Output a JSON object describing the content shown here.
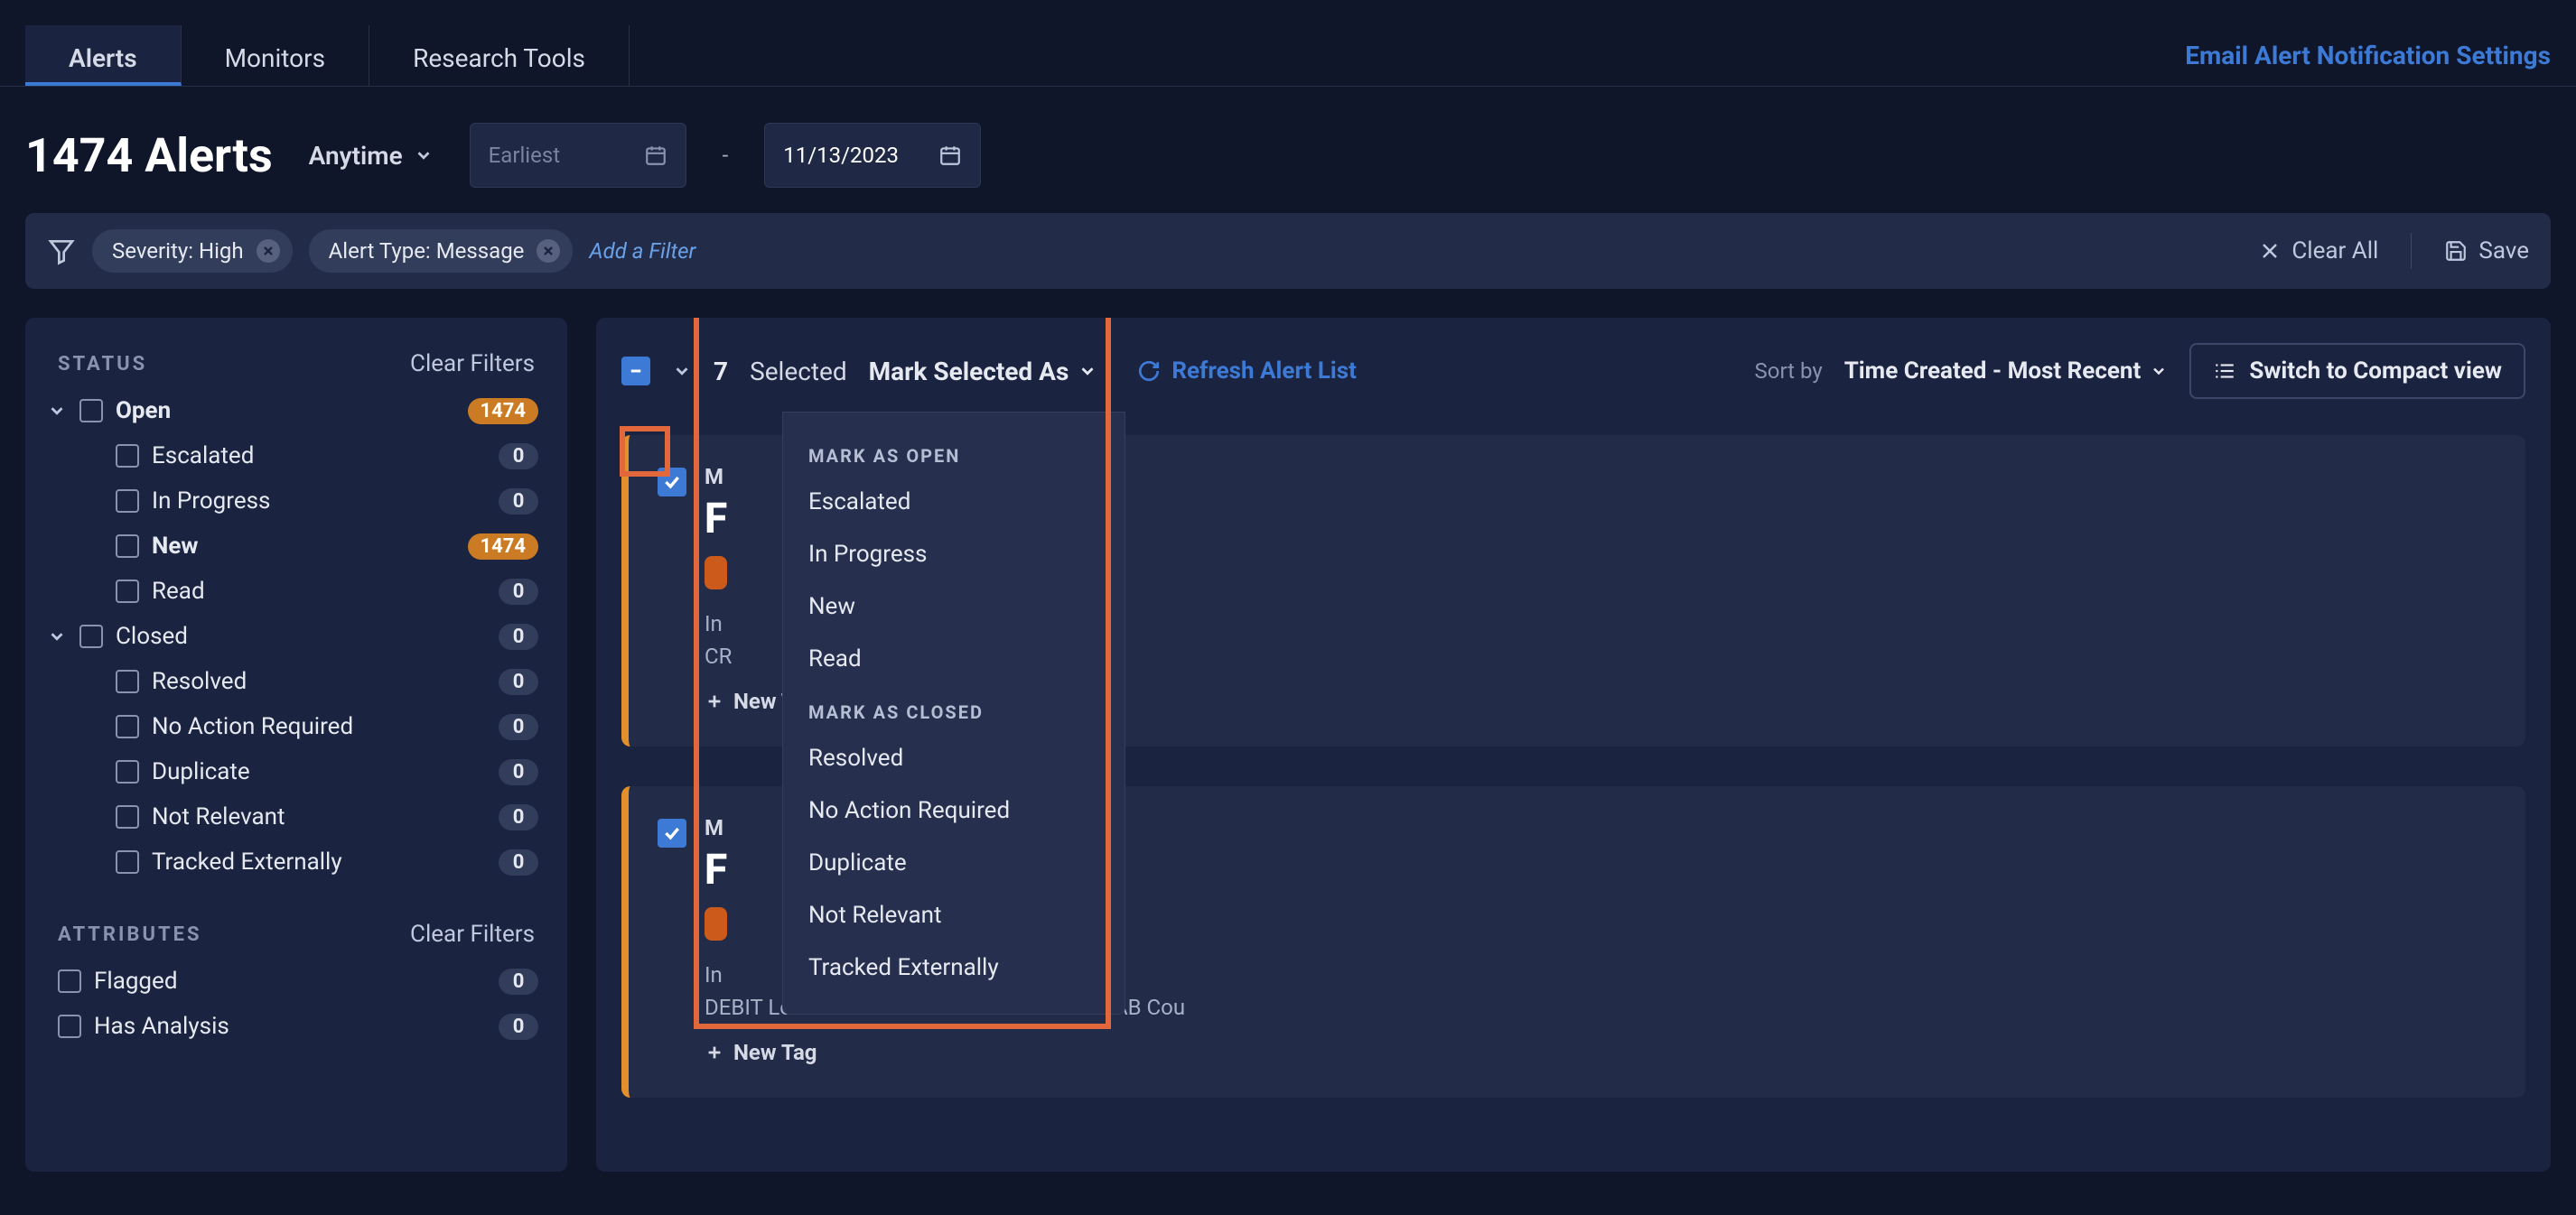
{
  "tabs": {
    "alerts": "Alerts",
    "monitors": "Monitors",
    "research": "Research Tools"
  },
  "email_settings": "Email Alert Notification Settings",
  "page_title": "1474 Alerts",
  "anytime": "Anytime",
  "earliest_placeholder": "Earliest",
  "end_date": "11/13/2023",
  "filter_pill1": "Severity: High",
  "filter_pill2": "Alert Type: Message",
  "add_filter": "Add a Filter",
  "clear_all": "Clear All",
  "save": "Save",
  "sidebar": {
    "status_label": "STATUS",
    "attributes_label": "ATTRIBUTES",
    "clear_filters": "Clear Filters",
    "open": {
      "label": "Open",
      "count": "1474"
    },
    "escalated": {
      "label": "Escalated",
      "count": "0"
    },
    "inprogress": {
      "label": "In Progress",
      "count": "0"
    },
    "new": {
      "label": "New",
      "count": "1474"
    },
    "read": {
      "label": "Read",
      "count": "0"
    },
    "closed": {
      "label": "Closed",
      "count": "0"
    },
    "resolved": {
      "label": "Resolved",
      "count": "0"
    },
    "noaction": {
      "label": "No Action Required",
      "count": "0"
    },
    "duplicate": {
      "label": "Duplicate",
      "count": "0"
    },
    "notrelevant": {
      "label": "Not Relevant",
      "count": "0"
    },
    "tracked": {
      "label": "Tracked Externally",
      "count": "0"
    },
    "flagged": {
      "label": "Flagged",
      "count": "0"
    },
    "hasanalysis": {
      "label": "Has Analysis",
      "count": "0"
    }
  },
  "toolbar": {
    "selected_count": "7",
    "selected_label": "Selected",
    "mark_as": "Mark Selected As",
    "refresh": "Refresh Alert List",
    "sort_by": "Sort by",
    "sort_value": "Time Created - Most Recent",
    "compact": "Switch to Compact view"
  },
  "dropdown": {
    "open_header": "MARK AS OPEN",
    "escalated": "Escalated",
    "inprogress": "In Progress",
    "new": "New",
    "read": "Read",
    "closed_header": "MARK AS CLOSED",
    "resolved": "Resolved",
    "noaction": "No Action Required",
    "duplicate": "Duplicate",
    "notrelevant": "Not Relevant",
    "tracked": "Tracked Externally"
  },
  "card1": {
    "crumb": "M",
    "title": "F",
    "desc1": "In",
    "desc2": "CR",
    "newtag": "New Tag"
  },
  "card2": {
    "crumb": "M",
    "title": "F",
    "desc1": "In",
    "desc2": "DEBIT Level STANDARD Bank SWEDBANK AB Cou",
    "newtag": "New Tag"
  }
}
